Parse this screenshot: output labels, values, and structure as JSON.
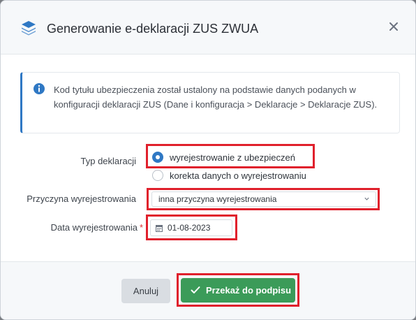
{
  "dialog": {
    "title": "Generowanie e-deklaracji ZUS ZWUA",
    "close_icon": "close-icon",
    "logo_icon": "stack-layers-icon"
  },
  "info": {
    "icon": "info-circle-icon",
    "text": "Kod tytułu ubezpieczenia został ustalony na podstawie danych podanych w konfiguracji deklaracji ZUS (Dane i konfiguracja > Deklaracje > Deklaracje ZUS)."
  },
  "form": {
    "typ_label": "Typ deklaracji",
    "typ_options": [
      {
        "label": "wyrejestrowanie z ubezpieczeń",
        "selected": true
      },
      {
        "label": "korekta danych o wyrejestrowaniu",
        "selected": false
      }
    ],
    "przyczyna_label": "Przyczyna wyrejestrowania",
    "przyczyna_value": "inna przyczyna wyrejestrowania",
    "data_label": "Data wyrejestrowania",
    "data_required_mark": "*",
    "data_value": "01-08-2023"
  },
  "footer": {
    "cancel_label": "Anuluj",
    "submit_label": "Przekaż do podpisu"
  },
  "colors": {
    "accent": "#2f78c4",
    "primary_button": "#3b9b59",
    "highlight": "#e0202c"
  }
}
